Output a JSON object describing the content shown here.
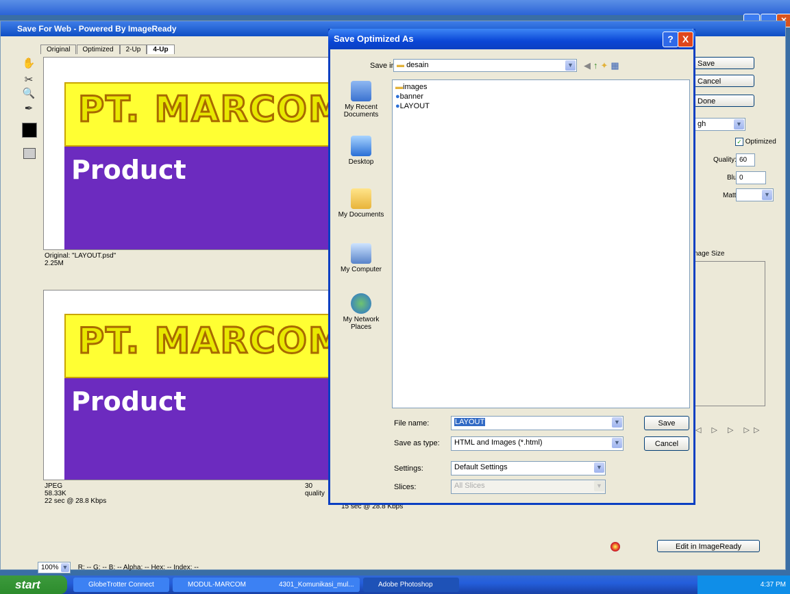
{
  "sfw": {
    "title": "Save For Web - Powered By ImageReady",
    "tabs": [
      "Original",
      "Optimized",
      "2-Up",
      "4-Up"
    ],
    "active_tab": "4-Up",
    "preview": {
      "company": "PT. MARCOM MA",
      "product": "Product"
    },
    "pane1": {
      "line1": "Original: \"LAYOUT.psd\"",
      "line2": "2.25M"
    },
    "pane2": {
      "line1": "JPEG",
      "line2": "58.33K",
      "line3": "22 sec @ 28.8 Kbps",
      "quality": "30 quality"
    },
    "pane3": {
      "line3": "15 sec @ 28.8 Kbps"
    },
    "right": {
      "save": "Save",
      "cancel": "Cancel",
      "done": "Done",
      "preset": "gh",
      "optimized": "Optimized",
      "quality_label": "Quality:",
      "quality_value": "60",
      "blur_label": "Blur:",
      "blur_value": "0",
      "matte_label": "Matte:",
      "image_size_tab": "nage Size",
      "edit_button": "Edit in ImageReady"
    },
    "status": {
      "zoom": "100%",
      "readout": "R:  --  G:  --  B:  --  Alpha:  --  Hex:        --  Index:   --"
    }
  },
  "dialog": {
    "title": "Save Optimized As",
    "help": "?",
    "close": "X",
    "save_in_label": "Save in:",
    "save_in_value": "desain",
    "places": [
      "My Recent Documents",
      "Desktop",
      "My Documents",
      "My Computer",
      "My Network Places"
    ],
    "files": [
      "images",
      "banner",
      "LAYOUT"
    ],
    "file_name_label": "File name:",
    "file_name_value": "LAYOUT",
    "save_as_type_label": "Save as type:",
    "save_as_type_value": "HTML and Images (*.html)",
    "settings_label": "Settings:",
    "settings_value": "Default Settings",
    "slices_label": "Slices:",
    "slices_value": "All Slices",
    "save_button": "Save",
    "cancel_button": "Cancel"
  },
  "taskbar": {
    "start": "start",
    "tasks": [
      "GlobeTrotter Connect",
      "MODUL-MARCOM",
      "4301_Komunikasi_mul...",
      "Adobe Photoshop"
    ],
    "clock": "4:37 PM"
  },
  "colors": {
    "banner_purple": "#6c2bbf",
    "banner_yellow": "#ffff33",
    "xp_blue": "#0a46d6"
  }
}
